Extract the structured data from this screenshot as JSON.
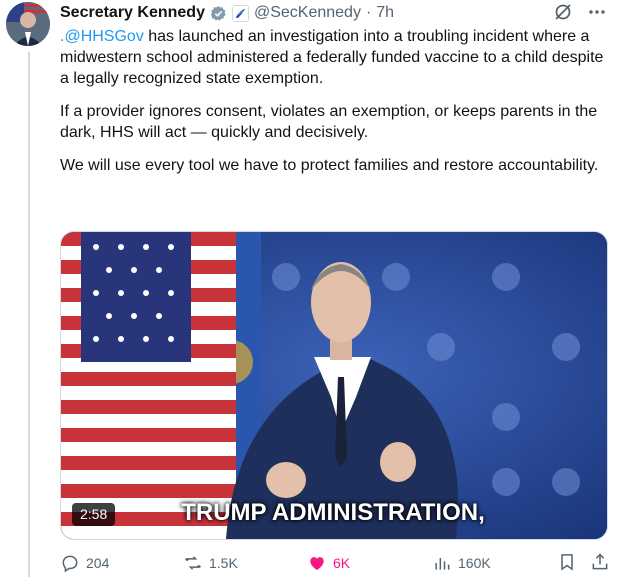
{
  "author": {
    "name": "Secretary Kennedy",
    "handle": "@SecKennedy",
    "separator": "·",
    "time": "7h"
  },
  "tweet": {
    "mention": ".@HHSGov",
    "p1_rest": " has launched an investigation into a troubling incident where a midwestern school administered a federally funded vaccine to a child despite a legally recognized state exemption.",
    "p2": "If a provider ignores consent, violates an exemption, or keeps parents in the dark, HHS will act — quickly and decisively.",
    "p3": "We will use every tool we have to protect families and restore accountability."
  },
  "video": {
    "duration": "2:58",
    "caption": "TRUMP ADMINISTRATION,"
  },
  "actions": {
    "replies": "204",
    "reposts": "1.5K",
    "likes": "6K",
    "views": "160K"
  },
  "colors": {
    "accent": "#1d9bf0",
    "like": "#f91880",
    "muted": "#536471"
  }
}
